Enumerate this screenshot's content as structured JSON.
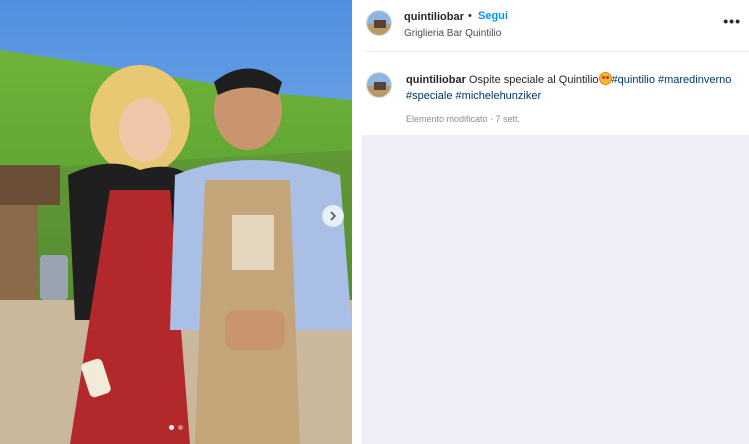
{
  "post": {
    "photo_alt": "",
    "carousel_total": 2,
    "carousel_active": 1,
    "next_arrow_icon": "chevron-right-icon"
  },
  "header": {
    "username": "quintiliobar",
    "separator": "•",
    "follow_label": "Segui",
    "location": "Griglieria Bar Quintilio",
    "more_icon": "more-options-icon",
    "more_label": "•••"
  },
  "caption": {
    "username": "quintiliobar",
    "text": "Ospite speciale al Quintilio",
    "emoji_icon": "star-struck-emoji-icon",
    "hashtags": [
      "#quintilio",
      "#maredinverno",
      "#speciale",
      "#michelehunziker"
    ],
    "edited": "Elemento modificato · 7 sett."
  },
  "colors": {
    "accent": "#0095f6",
    "hashtag": "#00376b",
    "comments_bg": "#eeeef9"
  }
}
